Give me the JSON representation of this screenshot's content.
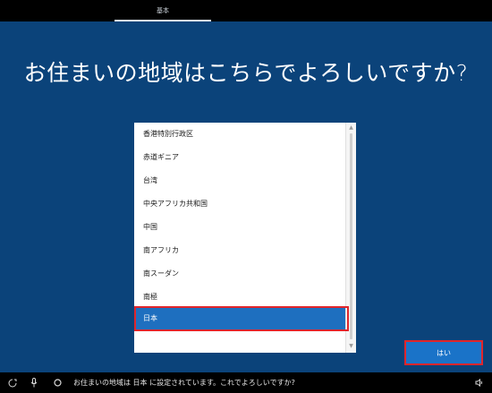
{
  "top_tab": {
    "label": "基本"
  },
  "question": {
    "title": "お住まいの地域はこちらでよろしいですか?"
  },
  "region_list": {
    "items": [
      {
        "label": "香港特別行政区",
        "selected": false
      },
      {
        "label": "赤道ギニア",
        "selected": false
      },
      {
        "label": "台湾",
        "selected": false
      },
      {
        "label": "中央アフリカ共和国",
        "selected": false
      },
      {
        "label": "中国",
        "selected": false
      },
      {
        "label": "南アフリカ",
        "selected": false
      },
      {
        "label": "南スーダン",
        "selected": false
      },
      {
        "label": "南極",
        "selected": false
      },
      {
        "label": "日本",
        "selected": true
      }
    ]
  },
  "actions": {
    "yes_label": "はい"
  },
  "status_bar": {
    "message": "お住まいの地域は 日本 に設定されています。これでよろしいですか?"
  },
  "colors": {
    "background": "#0b437a",
    "selected_item": "#1e6fbf",
    "button": "#1a73c8",
    "highlight": "#e0252b"
  }
}
